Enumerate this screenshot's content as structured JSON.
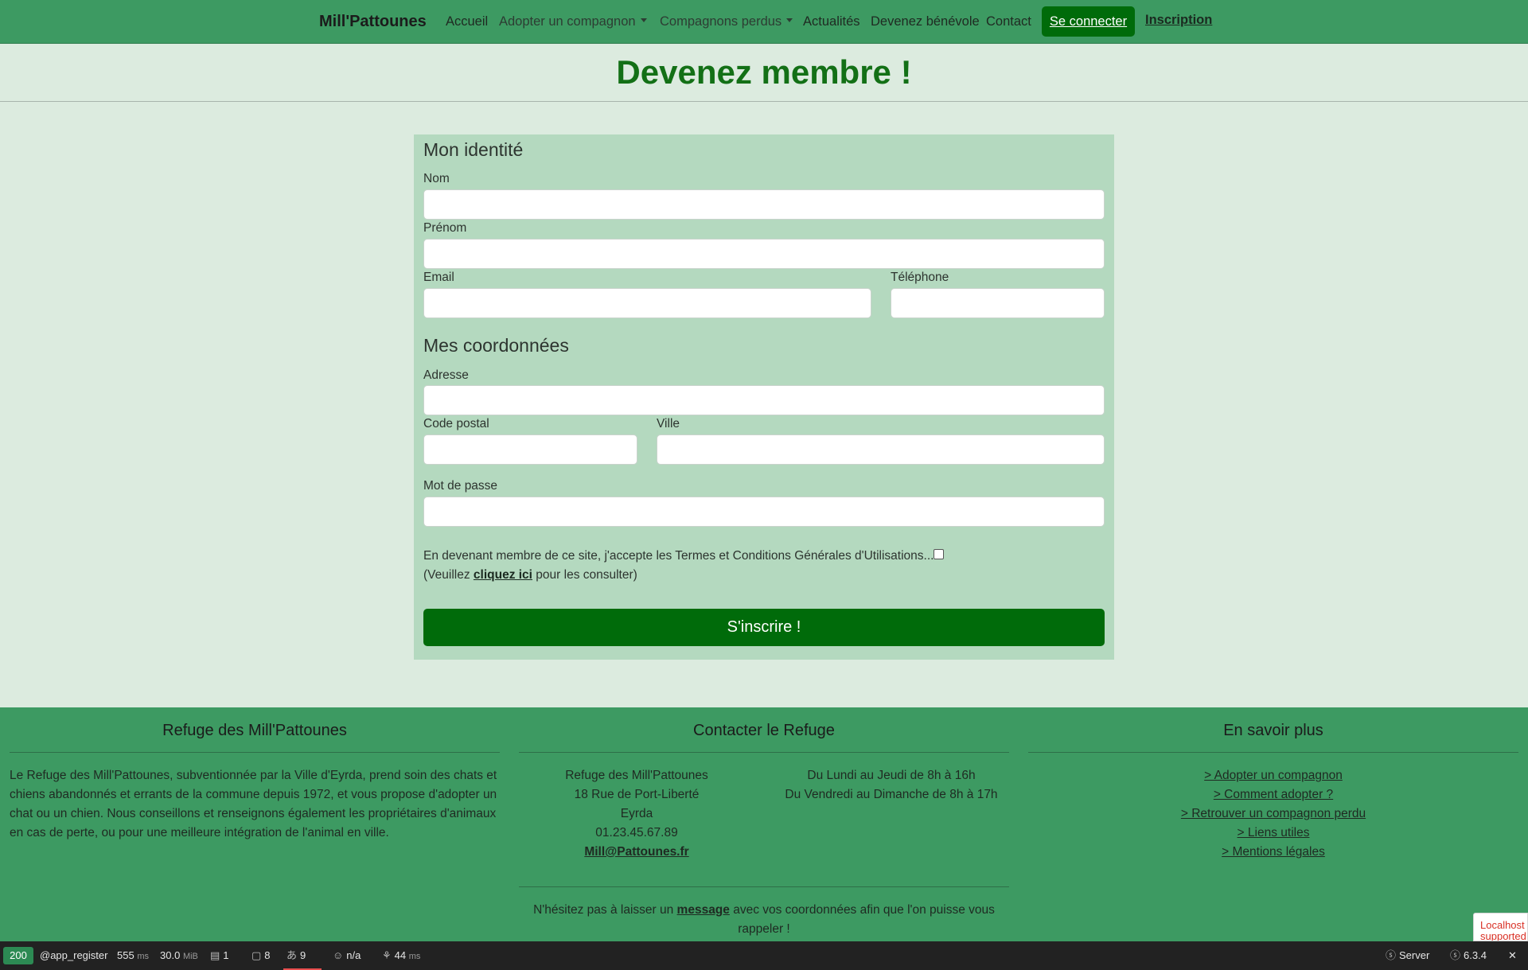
{
  "nav": {
    "brand": "Mill'Pattounes",
    "items": [
      {
        "label": "Accueil"
      },
      {
        "label": "Adopter un compagnon"
      },
      {
        "label": "Compagnons perdus"
      },
      {
        "label": "Actualités"
      },
      {
        "label": "Devenez bénévole"
      },
      {
        "label": "Contact"
      }
    ],
    "login": "Se connecter",
    "register": "Inscription"
  },
  "page": {
    "title": "Devenez membre !"
  },
  "form": {
    "identity_title": "Mon identité",
    "nom_label": "Nom",
    "prenom_label": "Prénom",
    "email_label": "Email",
    "telephone_label": "Téléphone",
    "coords_title": "Mes coordonnées",
    "adresse_label": "Adresse",
    "cp_label": "Code postal",
    "ville_label": "Ville",
    "password_label": "Mot de passe",
    "terms_text": "En devenant membre de ce site, j'accepte les Termes et Conditions Générales d'Utilisations...",
    "terms_pre": "(Veuillez ",
    "terms_link": "cliquez ici",
    "terms_post": " pour les consulter)",
    "submit": "S'inscrire !"
  },
  "footer": {
    "col1": {
      "title": "Refuge des Mill'Pattounes",
      "text": "Le Refuge des Mill'Pattounes, subventionnée par la Ville d'Eyrda, prend soin des chats et chiens abandonnés et errants de la commune depuis 1972, et vous propose d'adopter un chat ou un chien. Nous conseillons et renseignons également les propriétaires d'animaux en cas de perte, ou pour une meilleure intégration de l'animal en ville."
    },
    "col2": {
      "title": "Contacter le Refuge",
      "address": [
        "Refuge des Mill'Pattounes",
        "18 Rue de Port-Liberté",
        "Eyrda",
        "01.23.45.67.89"
      ],
      "email": "Mill@Pattounes.fr",
      "hours": [
        "Du Lundi au Jeudi de 8h à 16h",
        "Du Vendredi au Dimanche de 8h à 17h"
      ],
      "msg_pre": "N'hésitez pas à laisser un ",
      "msg_link": "message",
      "msg_post": " avec vos coordonnées afin que l'on puisse vous rappeler !"
    },
    "col3": {
      "title": "En savoir plus",
      "links": [
        "> Adopter un compagnon",
        "> Comment adopter ?",
        "> Retrouver un compagnon perdu",
        "> Liens utiles",
        "> Mentions légales"
      ]
    }
  },
  "recaptcha": {
    "text": "Localhost supported"
  },
  "toolbar": {
    "status": "200",
    "route": "@app_register",
    "time": "555",
    "time_unit": "ms",
    "memory": "30.0",
    "memory_unit": "MiB",
    "logs": "1",
    "forms": "8",
    "translations": "9",
    "user": "n/a",
    "twig": "44",
    "twig_unit": "ms",
    "server": "Server",
    "version": "6.3.4",
    "close": "✕"
  }
}
